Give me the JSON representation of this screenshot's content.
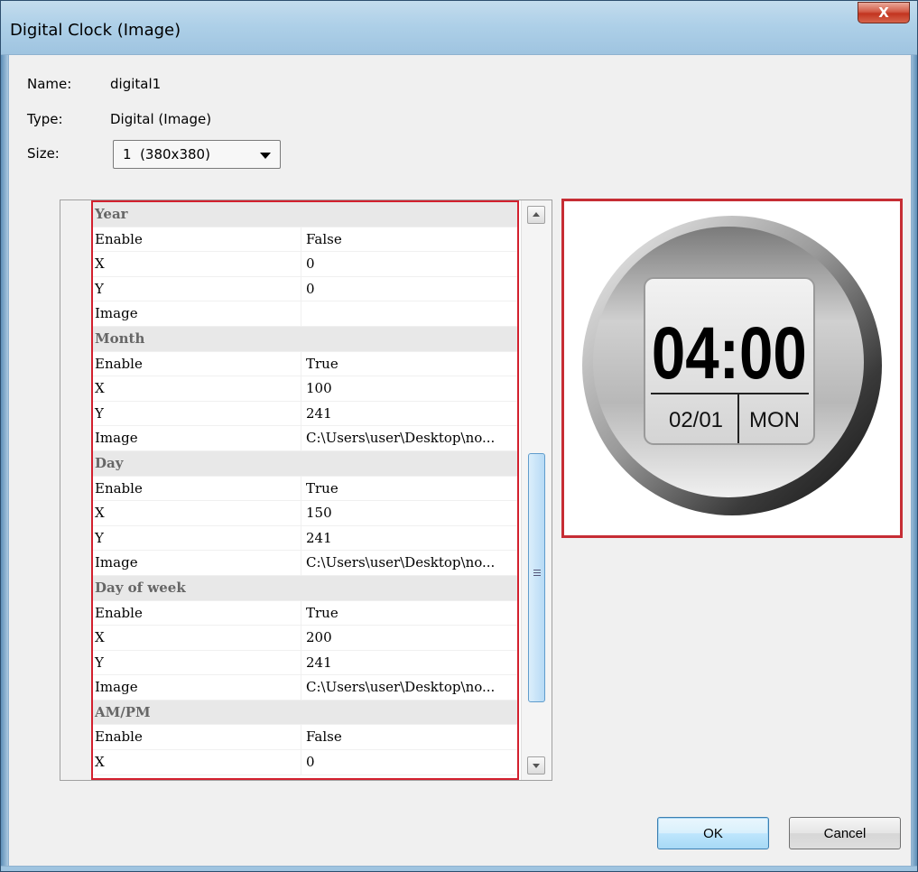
{
  "window": {
    "title": "Digital Clock (Image)",
    "close_label": "X"
  },
  "info": {
    "name_label": "Name:",
    "name_value": "digital1",
    "type_label": "Type:",
    "type_value": "Digital (Image)",
    "size_label": "Size:",
    "size_value": "1  (380x380)"
  },
  "grid": {
    "rows": [
      {
        "kind": "category",
        "name": "Year"
      },
      {
        "kind": "prop",
        "name": "Enable",
        "value": "False"
      },
      {
        "kind": "prop",
        "name": "X",
        "value": "0"
      },
      {
        "kind": "prop",
        "name": "Y",
        "value": "0"
      },
      {
        "kind": "prop",
        "name": "Image",
        "value": ""
      },
      {
        "kind": "category",
        "name": "Month"
      },
      {
        "kind": "prop",
        "name": "Enable",
        "value": "True"
      },
      {
        "kind": "prop",
        "name": "X",
        "value": "100"
      },
      {
        "kind": "prop",
        "name": "Y",
        "value": "241"
      },
      {
        "kind": "prop",
        "name": "Image",
        "value": "C:\\Users\\user\\Desktop\\no..."
      },
      {
        "kind": "category",
        "name": "Day"
      },
      {
        "kind": "prop",
        "name": "Enable",
        "value": "True"
      },
      {
        "kind": "prop",
        "name": "X",
        "value": "150"
      },
      {
        "kind": "prop",
        "name": "Y",
        "value": "241"
      },
      {
        "kind": "prop",
        "name": "Image",
        "value": "C:\\Users\\user\\Desktop\\no..."
      },
      {
        "kind": "category",
        "name": "Day of week"
      },
      {
        "kind": "prop",
        "name": "Enable",
        "value": "True"
      },
      {
        "kind": "prop",
        "name": "X",
        "value": "200"
      },
      {
        "kind": "prop",
        "name": "Y",
        "value": "241"
      },
      {
        "kind": "prop",
        "name": "Image",
        "value": "C:\\Users\\user\\Desktop\\no..."
      },
      {
        "kind": "category",
        "name": "AM/PM"
      },
      {
        "kind": "prop",
        "name": "Enable",
        "value": "False"
      },
      {
        "kind": "prop",
        "name": "X",
        "value": "0"
      }
    ]
  },
  "preview": {
    "time": "04:00",
    "date": "02/01",
    "weekday": "MON"
  },
  "buttons": {
    "ok": "OK",
    "cancel": "Cancel"
  },
  "colors": {
    "highlight_border": "#d3202e",
    "title_bar": "#aed0e8"
  }
}
